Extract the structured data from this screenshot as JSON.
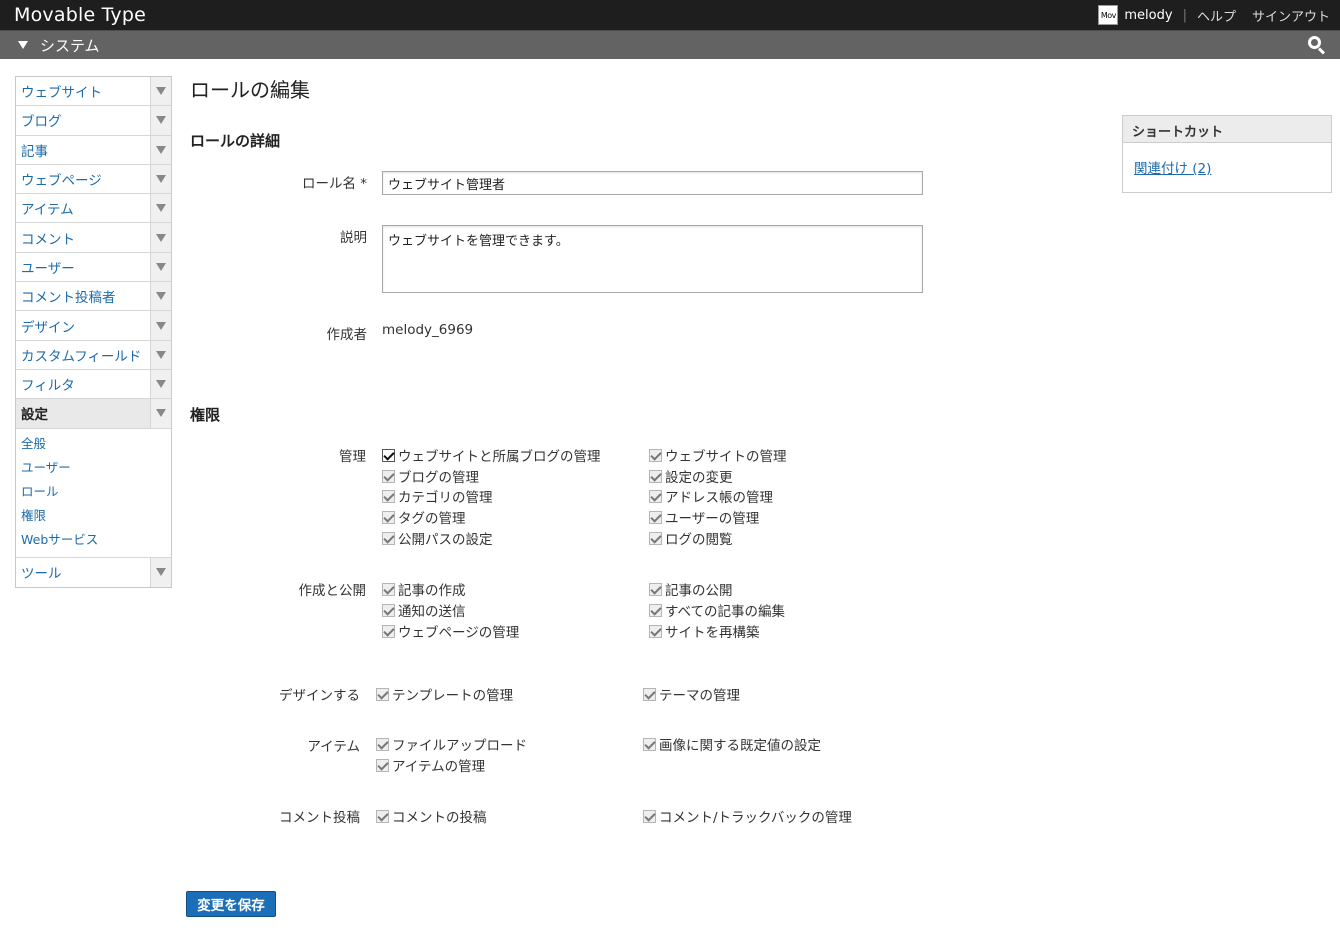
{
  "app": {
    "brand": "Movable Type",
    "avatar_text": "Mov",
    "user": "melody",
    "help": "ヘルプ",
    "signout": "サインアウト",
    "separator": "|"
  },
  "scope": {
    "label": "システム"
  },
  "sidebar": {
    "items": [
      {
        "label": "ウェブサイト"
      },
      {
        "label": "ブログ"
      },
      {
        "label": "記事"
      },
      {
        "label": "ウェブページ"
      },
      {
        "label": "アイテム"
      },
      {
        "label": "コメント"
      },
      {
        "label": "ユーザー"
      },
      {
        "label": "コメント投稿者"
      },
      {
        "label": "デザイン"
      },
      {
        "label": "カスタムフィールド"
      },
      {
        "label": "フィルタ"
      },
      {
        "label": "設定"
      },
      {
        "label": "ツール"
      }
    ],
    "settings_sub": [
      "全般",
      "ユーザー",
      "ロール",
      "権限",
      "Webサービス"
    ]
  },
  "page": {
    "title": "ロールの編集",
    "section_details": "ロールの詳細",
    "role_name_label": "ロール名 *",
    "role_name_value": "ウェブサイト管理者",
    "description_label": "説明",
    "description_value": "ウェブサイトを管理できます。",
    "created_by_label": "作成者",
    "created_by_value": "melody_6969",
    "section_permissions": "権限",
    "save_button": "変更を保存"
  },
  "permissions": {
    "admin": {
      "label": "管理",
      "left": [
        "ウェブサイトと所属ブログの管理",
        "ブログの管理",
        "カテゴリの管理",
        "タグの管理",
        "公開パスの設定"
      ],
      "right": [
        "ウェブサイトの管理",
        "設定の変更",
        "アドレス帳の管理",
        "ユーザーの管理",
        "ログの閲覧"
      ]
    },
    "create": {
      "label": "作成と公開",
      "left": [
        "記事の作成",
        "通知の送信",
        "ウェブページの管理"
      ],
      "right": [
        "記事の公開",
        "すべての記事の編集",
        "サイトを再構築"
      ]
    },
    "design": {
      "label": "デザインする",
      "left": [
        "テンプレートの管理"
      ],
      "right": [
        "テーマの管理"
      ]
    },
    "asset": {
      "label": "アイテム",
      "left": [
        "ファイルアップロード",
        "アイテムの管理"
      ],
      "right": [
        "画像に関する既定値の設定"
      ]
    },
    "comment": {
      "label": "コメント投稿",
      "left": [
        "コメントの投稿"
      ],
      "right": [
        "コメント/トラックバックの管理"
      ]
    }
  },
  "shortcut": {
    "title": "ショートカット",
    "link": "関連付け (2)"
  }
}
